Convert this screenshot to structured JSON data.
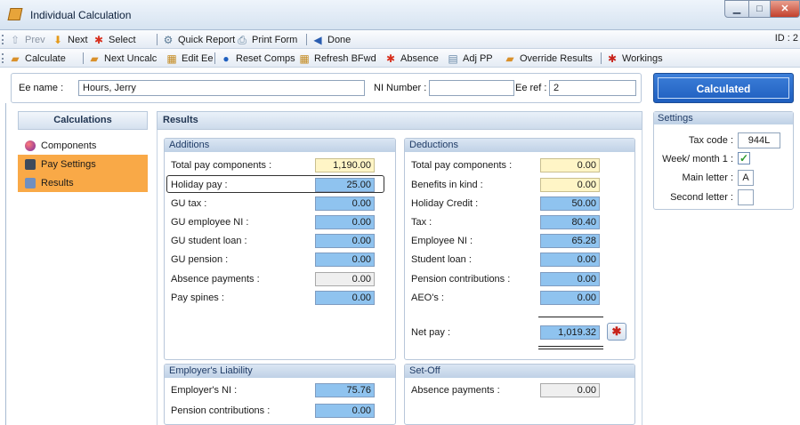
{
  "window": {
    "title": "Individual Calculation",
    "id_label": "ID : 2"
  },
  "toolbar1": {
    "prev": "Prev",
    "next": "Next",
    "select": "Select",
    "quick_report": "Quick Report",
    "print_form": "Print Form",
    "done": "Done"
  },
  "toolbar2": {
    "calculate": "Calculate",
    "next_uncalc": "Next Uncalc",
    "edit_ee": "Edit Ee",
    "reset_comps": "Reset Comps",
    "refresh_bfwd": "Refresh BFwd",
    "absence": "Absence",
    "adj_pp": "Adj PP",
    "override_results": "Override Results",
    "workings": "Workings"
  },
  "header": {
    "ee_name_label": "Ee name :",
    "ee_name": "Hours, Jerry",
    "ni_label": "NI Number :",
    "ni_number": "",
    "ee_ref_label": "Ee ref :",
    "ee_ref": "2",
    "status_button": "Calculated"
  },
  "nav": {
    "title": "Calculations",
    "items": [
      {
        "label": "Components",
        "icon": "components-icon",
        "selected": false
      },
      {
        "label": "Pay Settings",
        "icon": "pay-settings-icon",
        "selected": true
      },
      {
        "label": "Results",
        "icon": "results-icon",
        "selected": true
      }
    ]
  },
  "results": {
    "title": "Results",
    "additions": {
      "title": "Additions",
      "rows": [
        {
          "label": "Total pay components :",
          "value": "1,190.00",
          "style": "yellow"
        },
        {
          "label": "Holiday pay :",
          "value": "25.00",
          "style": "blue"
        },
        {
          "label": "GU tax :",
          "value": "0.00",
          "style": "blue"
        },
        {
          "label": "GU employee NI :",
          "value": "0.00",
          "style": "blue"
        },
        {
          "label": "GU student loan :",
          "value": "0.00",
          "style": "blue"
        },
        {
          "label": "GU pension :",
          "value": "0.00",
          "style": "blue"
        },
        {
          "label": "Absence payments :",
          "value": "0.00",
          "style": "grey"
        },
        {
          "label": "Pay spines :",
          "value": "0.00",
          "style": "blue"
        }
      ]
    },
    "deductions": {
      "title": "Deductions",
      "rows": [
        {
          "label": "Total pay components :",
          "value": "0.00",
          "style": "yellow"
        },
        {
          "label": "Benefits in kind :",
          "value": "0.00",
          "style": "yellow"
        },
        {
          "label": "Holiday Credit :",
          "value": "50.00",
          "style": "blue"
        },
        {
          "label": "Tax :",
          "value": "80.40",
          "style": "blue"
        },
        {
          "label": "Employee NI :",
          "value": "65.28",
          "style": "blue"
        },
        {
          "label": "Student loan :",
          "value": "0.00",
          "style": "blue"
        },
        {
          "label": "Pension contributions :",
          "value": "0.00",
          "style": "blue"
        },
        {
          "label": "AEO's :",
          "value": "0.00",
          "style": "blue"
        }
      ],
      "net_pay_label": "Net pay :",
      "net_pay": "1,019.32"
    },
    "employers_liability": {
      "title": "Employer's Liability",
      "rows": [
        {
          "label": "Employer's NI :",
          "value": "75.76",
          "style": "blue"
        },
        {
          "label": "Pension contributions :",
          "value": "0.00",
          "style": "blue"
        }
      ]
    },
    "set_off": {
      "title": "Set-Off",
      "rows": [
        {
          "label": "Absence payments :",
          "value": "0.00",
          "style": "grey"
        }
      ]
    }
  },
  "settings": {
    "title": "Settings",
    "tax_code_label": "Tax code :",
    "tax_code": "944L",
    "week_month_label": "Week/ month 1 :",
    "week_month_checked": true,
    "main_letter_label": "Main letter :",
    "main_letter": "A",
    "second_letter_label": "Second letter :",
    "second_letter": ""
  },
  "colors": {
    "accent_blue": "#8fc3ef",
    "selected_nav": "#f9a947",
    "status_button": "#2b6fd0"
  }
}
